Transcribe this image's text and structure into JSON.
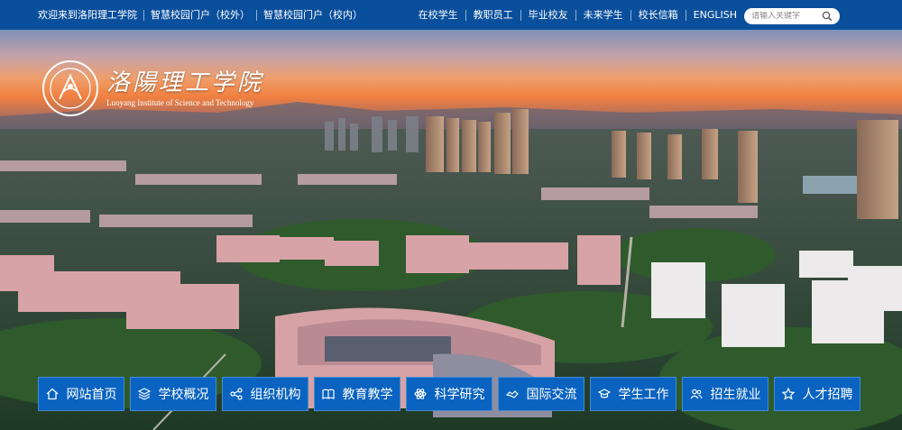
{
  "topbar": {
    "left_links": [
      "欢迎来到洛阳理工学院",
      "智慧校园门户（校外）",
      "智慧校园门户（校内）"
    ],
    "right_links": [
      "在校学生",
      "教职员工",
      "毕业校友",
      "未来学生",
      "校长信箱",
      "ENGLISH"
    ],
    "search_placeholder": "请输入关键字",
    "search_icon": "search-icon"
  },
  "logo": {
    "cn": "洛陽理工学院",
    "en": "Luoyang Institute of Science and Technology",
    "seal_icon": "university-seal"
  },
  "nav": [
    {
      "label": "网站首页",
      "icon": "home-icon"
    },
    {
      "label": "学校概况",
      "icon": "layers-icon"
    },
    {
      "label": "组织机构",
      "icon": "share-icon"
    },
    {
      "label": "教育教学",
      "icon": "book-icon"
    },
    {
      "label": "科学研究",
      "icon": "atom-icon"
    },
    {
      "label": "国际交流",
      "icon": "handshake-icon"
    },
    {
      "label": "学生工作",
      "icon": "graduation-cap-icon"
    },
    {
      "label": "招生就业",
      "icon": "people-icon"
    },
    {
      "label": "人才招聘",
      "icon": "star-icon"
    }
  ],
  "colors": {
    "topbar": "#0a4f9c",
    "nav_item": "#0a63c0"
  }
}
